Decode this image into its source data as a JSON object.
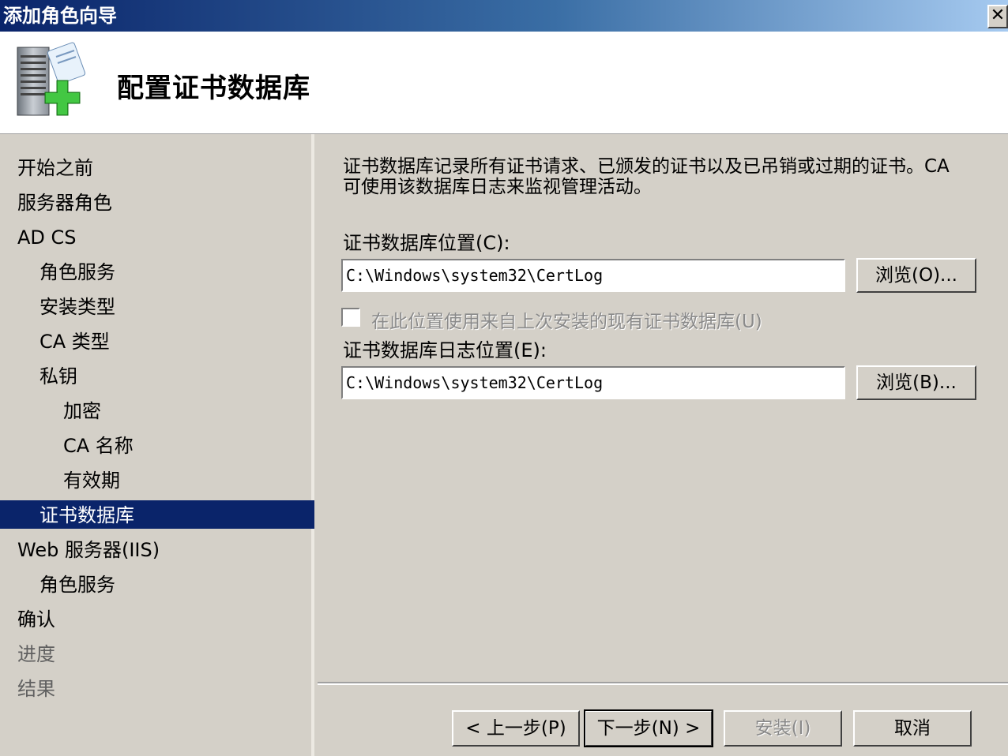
{
  "window": {
    "title": "添加角色向导",
    "close_glyph": "✕"
  },
  "header": {
    "title": "配置证书数据库",
    "icon": "server-add-role-icon"
  },
  "nav": {
    "items": [
      {
        "label": "开始之前"
      },
      {
        "label": "服务器角色"
      },
      {
        "label": "AD CS"
      },
      {
        "label": "角色服务"
      },
      {
        "label": "安装类型"
      },
      {
        "label": "CA 类型"
      },
      {
        "label": "私钥"
      },
      {
        "label": "加密"
      },
      {
        "label": "CA 名称"
      },
      {
        "label": "有效期"
      },
      {
        "label": "证书数据库"
      },
      {
        "label": "Web 服务器(IIS)"
      },
      {
        "label": "角色服务"
      },
      {
        "label": "确认"
      },
      {
        "label": "进度"
      },
      {
        "label": "结果"
      }
    ],
    "active": "证书数据库"
  },
  "content": {
    "description_line1": "证书数据库记录所有证书请求、已颁发的证书以及已吊销或过期的证书。CA",
    "description_line2": "可使用该数据库日志来监视管理活动。",
    "db_location_label": "证书数据库位置(C):",
    "db_location_value": "C:\\Windows\\system32\\CertLog",
    "browse_db_label": "浏览(O)...",
    "use_existing_label": "在此位置使用来自上次安装的现有证书数据库(U)",
    "use_existing_checked": false,
    "log_location_label": "证书数据库日志位置(E):",
    "log_location_value": "C:\\Windows\\system32\\CertLog",
    "browse_log_label": "浏览(B)..."
  },
  "footer": {
    "back_label": "< 上一步(P)",
    "next_label": "下一步(N) >",
    "install_label": "安装(I)",
    "cancel_label": "取消"
  },
  "colors": {
    "titlebar": "#0a246a",
    "active_nav": "#0a246a",
    "face": "#d4d0c8"
  }
}
